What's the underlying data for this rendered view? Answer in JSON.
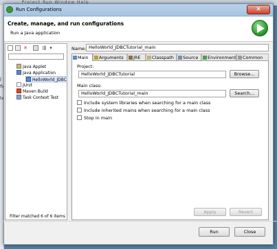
{
  "background": {
    "menu": "...  Project   Run   Window   Help",
    "frag1": "J",
    "frag2": "fig",
    "frag3": "te"
  },
  "window": {
    "title": "Run Configurations",
    "close_label": "✕"
  },
  "header": {
    "title": "Create, manage, and run configurations",
    "subtitle": "Run a Java application"
  },
  "left_pane": {
    "tree": [
      {
        "label": "Java Applet",
        "icon": "applet-icon"
      },
      {
        "label": "Java Application",
        "icon": "java-application-icon"
      },
      {
        "label": "HelloWorld_JDBC",
        "icon": "java-application-icon"
      },
      {
        "label": "JUnit",
        "icon": "junit-icon"
      },
      {
        "label": "Maven Build",
        "icon": "maven-icon"
      },
      {
        "label": "Task Context Test",
        "icon": "task-icon"
      }
    ],
    "filter_status": "Filter matched 6 of 6 items"
  },
  "config": {
    "name_label": "Name:",
    "name_value": "HelloWorld_JDBCTutorial_main",
    "tabs": [
      "Main",
      "Arguments",
      "JRE",
      "Classpath",
      "Source",
      "Environment",
      "Common"
    ],
    "active_tab": "Main",
    "project_label": "Project:",
    "project_value": "HelloWorld_JDBCTutorial",
    "browse_label": "Browse...",
    "main_class_label": "Main class:",
    "main_class_value": "HelloWorld_JDBCTutorial_main",
    "search_label": "Search...",
    "checkboxes": [
      "Include system libraries when searching for a main class",
      "Include inherited mains when searching for a main class",
      "Stop in main"
    ],
    "apply_label": "Apply",
    "revert_label": "Revert"
  },
  "footer": {
    "run_label": "Run",
    "close_label": "Close"
  },
  "colors": {
    "title_bar": "#b9d1ea",
    "selection": "#dbe9f9",
    "run_icon": "#2e9e2e"
  }
}
